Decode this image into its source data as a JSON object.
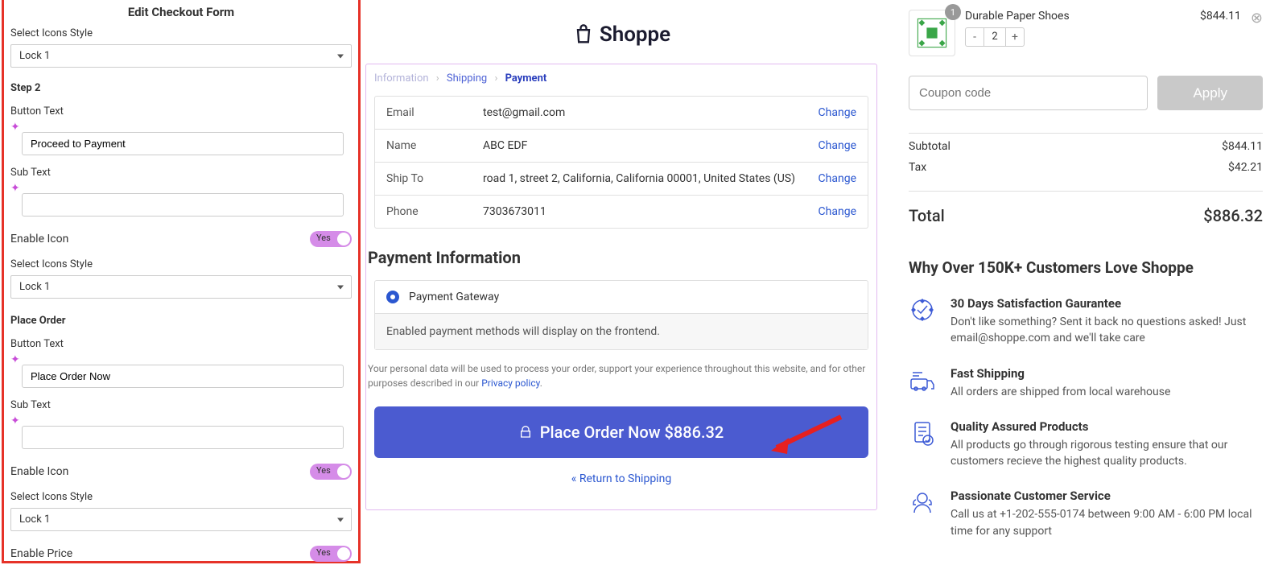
{
  "edit": {
    "title": "Edit Checkout Form",
    "select_icons_label": "Select Icons Style",
    "lock1": "Lock 1",
    "step2_label": "Step 2",
    "button_text_label": "Button Text",
    "step2_button_text": "Proceed to Payment",
    "sub_text_label": "Sub Text",
    "step2_sub_text": "",
    "enable_icon_label": "Enable Icon",
    "yes": "Yes",
    "place_order_label": "Place Order",
    "place_button_text": "Place Order Now",
    "place_sub_text": "",
    "enable_price_label": "Enable Price"
  },
  "preview": {
    "brand": "Shoppe",
    "bc_information": "Information",
    "bc_shipping": "Shipping",
    "bc_payment": "Payment",
    "rows": {
      "email_label": "Email",
      "email_val": "test@gmail.com",
      "name_label": "Name",
      "name_val": "ABC EDF",
      "ship_label": "Ship To",
      "ship_val": "road 1, street 2, California, California 00001, United States (US)",
      "phone_label": "Phone",
      "phone_val": "7303673011",
      "change": "Change"
    },
    "payment_h": "Payment Information",
    "gateway_label": "Payment Gateway",
    "gateway_note": "Enabled payment methods will display on the frontend.",
    "privacy1": "Your personal data will be used to process your order, support your experience throughout this website, and for other purposes described in our ",
    "privacy_link": "Privacy policy",
    "place_button": "Place Order Now  $886.32",
    "return_link": "« Return to Shipping"
  },
  "cart": {
    "item_name": "Durable Paper Shoes",
    "item_price": "$844.11",
    "badge": "1",
    "qty": "2",
    "coupon_placeholder": "Coupon code",
    "apply": "Apply",
    "subtotal_label": "Subtotal",
    "subtotal_val": "$844.11",
    "tax_label": "Tax",
    "tax_val": "$42.21",
    "total_label": "Total",
    "total_val": "$886.32",
    "love_h": "Why Over 150K+ Customers Love Shoppe",
    "benefits": [
      {
        "h": "30 Days Satisfaction Gaurantee",
        "d": "Don't like something? Sent it back no questions asked! Just email@shoppe.com and we'll take care"
      },
      {
        "h": "Fast Shipping",
        "d": "All orders are shipped from local warehouse"
      },
      {
        "h": "Quality Assured Products",
        "d": "All products go through rigorous testing ensure that our customers recieve the highest quality products."
      },
      {
        "h": "Passionate Customer Service",
        "d": "Call us at +1-202-555-0174 between 9:00 AM - 6:00 PM local time for any support"
      }
    ]
  }
}
